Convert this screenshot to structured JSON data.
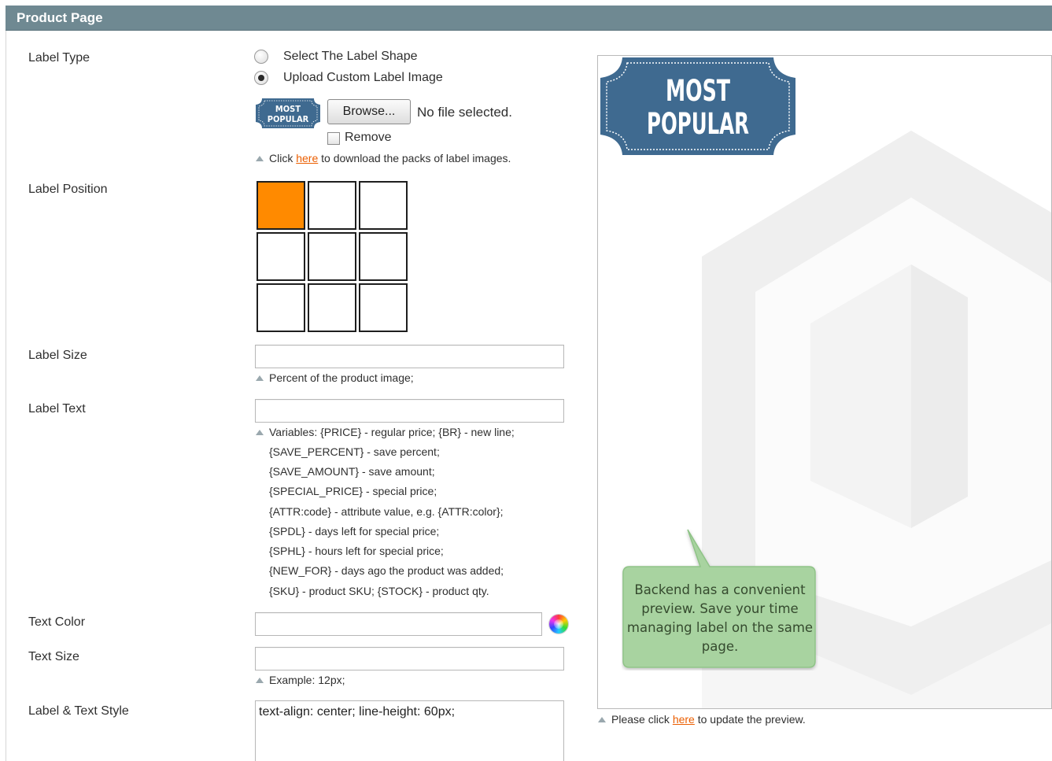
{
  "section": {
    "title": "Product Page"
  },
  "labels": {
    "label_type": "Label Type",
    "label_position": "Label Position",
    "label_size": "Label Size",
    "label_text": "Label Text",
    "text_color": "Text Color",
    "text_size": "Text Size",
    "label_text_style": "Label & Text Style"
  },
  "label_type": {
    "options": [
      "Select The Label Shape",
      "Upload Custom Label Image"
    ],
    "selected": "Upload Custom Label Image",
    "badge_lines": [
      "MOST",
      "POPULAR"
    ],
    "browse_label": "Browse...",
    "file_status": "No file selected.",
    "remove_label": "Remove",
    "note_before": "Click ",
    "note_link": "here",
    "note_after": " to download the packs of label images."
  },
  "label_position": {
    "selected_cell": "top-left",
    "rows": 3,
    "cols": 3
  },
  "label_size": {
    "value": "",
    "note": "Percent of the product image;"
  },
  "label_text": {
    "value": "",
    "variables": [
      "Variables: {PRICE} - regular price; {BR} - new line;",
      "{SAVE_PERCENT} - save percent;",
      "{SAVE_AMOUNT} - save amount;",
      "{SPECIAL_PRICE} - special price;",
      "{ATTR:code} - attribute value, e.g. {ATTR:color};",
      "{SPDL} - days left for special price;",
      "{SPHL} - hours left for special price;",
      "{NEW_FOR} - days ago the product was added;",
      "{SKU} - product SKU; {STOCK} - product qty."
    ]
  },
  "text_color": {
    "value": "",
    "picker_icon": "color-wheel-icon"
  },
  "text_size": {
    "value": "",
    "note": "Example: 12px;"
  },
  "label_text_style": {
    "value": "text-align: center; line-height: 60px;"
  },
  "preview": {
    "badge_lines": [
      "MOST",
      "POPULAR"
    ],
    "callout": "Backend has a convenient preview. Save your time managing label on the same page.",
    "note_before": "Please click ",
    "note_link": "here",
    "note_after": " to update the preview."
  },
  "colors": {
    "header": "#6f8992",
    "badge": "#3f6a90",
    "selected_cell": "#ff8a00",
    "link": "#eb5e00",
    "callout": "#a8d3a0"
  }
}
